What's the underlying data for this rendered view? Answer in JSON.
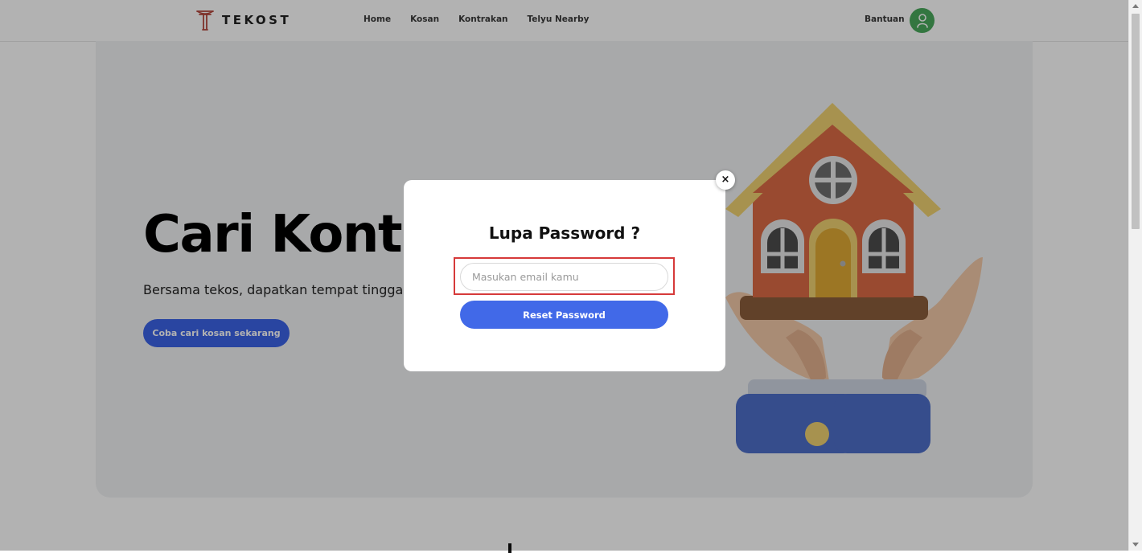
{
  "nav": {
    "brand": "TEKOST",
    "links": [
      "Home",
      "Kosan",
      "Kontrakan",
      "Telyu Nearby"
    ],
    "help": "Bantuan"
  },
  "hero": {
    "title": "Cari Kontr",
    "subtitle": "Bersama tekos, dapatkan tempat tingga",
    "cta": "Coba cari kosan sekarang"
  },
  "modal": {
    "title": "Lupa Password ?",
    "email_placeholder": "Masukan email kamu",
    "email_value": "",
    "submit_label": "Reset Password",
    "close_label": "×"
  },
  "colors": {
    "primary": "#4169e8",
    "avatar": "#4aa95c",
    "highlight": "#d63a3a",
    "logo": "#b5473d"
  },
  "icons": {
    "logo": "tekost-logo-icon",
    "avatar": "user-icon",
    "close": "close-icon"
  }
}
